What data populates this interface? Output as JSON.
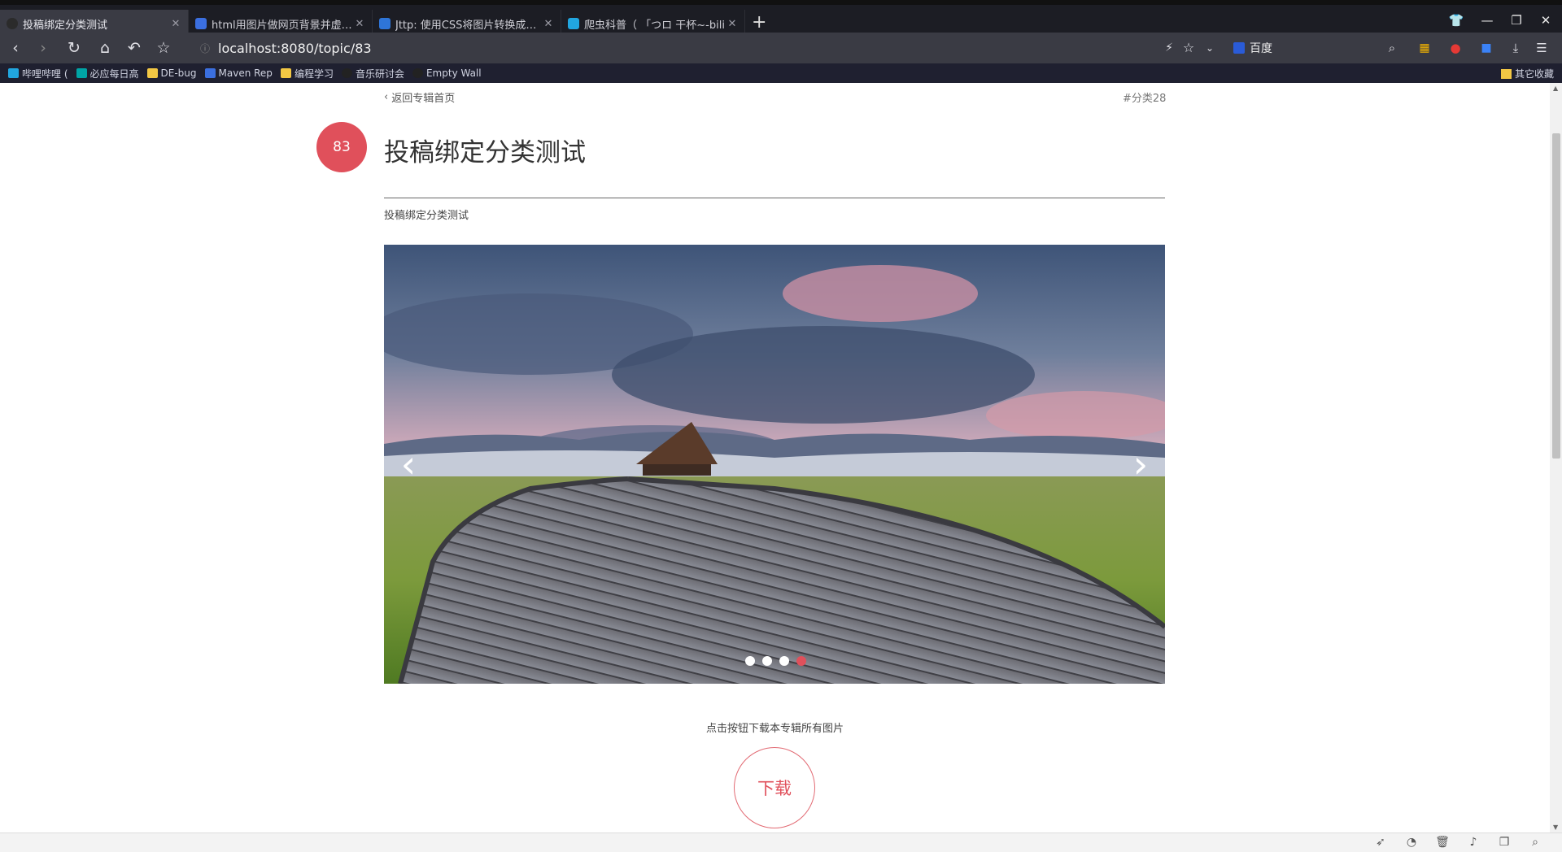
{
  "tabs": [
    {
      "title": "投稿绑定分类测试",
      "favicon_color": "#2b2b2b",
      "active": true
    },
    {
      "title": "html用图片做网页背景并虚化_百",
      "favicon_color": "#3b6fe0",
      "active": false
    },
    {
      "title": "Jttp: 使用CSS将图片转换成模糊",
      "favicon_color": "#2e75d8",
      "active": false
    },
    {
      "title": "爬虫科普（ 「つロ 干杯~-bili",
      "favicon_color": "#21a6e0",
      "active": false
    }
  ],
  "toolbar": {
    "url": "localhost:8080/topic/83",
    "search_engine": "百度"
  },
  "bookmarks": [
    {
      "label": "哔哩哔哩 (",
      "icon": "bilibili-icon",
      "color": "#21a6e0"
    },
    {
      "label": "必应每日高",
      "icon": "bing-icon",
      "color": "#00a4a6"
    },
    {
      "label": "DE-bug",
      "icon": "folder-icon",
      "color": "#f2c744"
    },
    {
      "label": "Maven Rep",
      "icon": "maven-icon",
      "color": "#3b6fe0"
    },
    {
      "label": "编程学习",
      "icon": "folder-icon",
      "color": "#f2c744"
    },
    {
      "label": "音乐研讨会",
      "icon": "music-icon",
      "color": "#222"
    },
    {
      "label": "Empty Wall",
      "icon": "github-icon",
      "color": "#222"
    }
  ],
  "bookmarks_other": "其它收藏",
  "page": {
    "back_link": "返回专辑首页",
    "category_tag": "#分类28",
    "topic_id": "83",
    "title": "投稿绑定分类测试",
    "description": "投稿绑定分类测试",
    "carousel": {
      "slide_count": 4,
      "active_index": 3,
      "accent": "#e0505b"
    },
    "download_hint": "点击按钮下载本专辑所有图片",
    "download_label": "下载"
  }
}
